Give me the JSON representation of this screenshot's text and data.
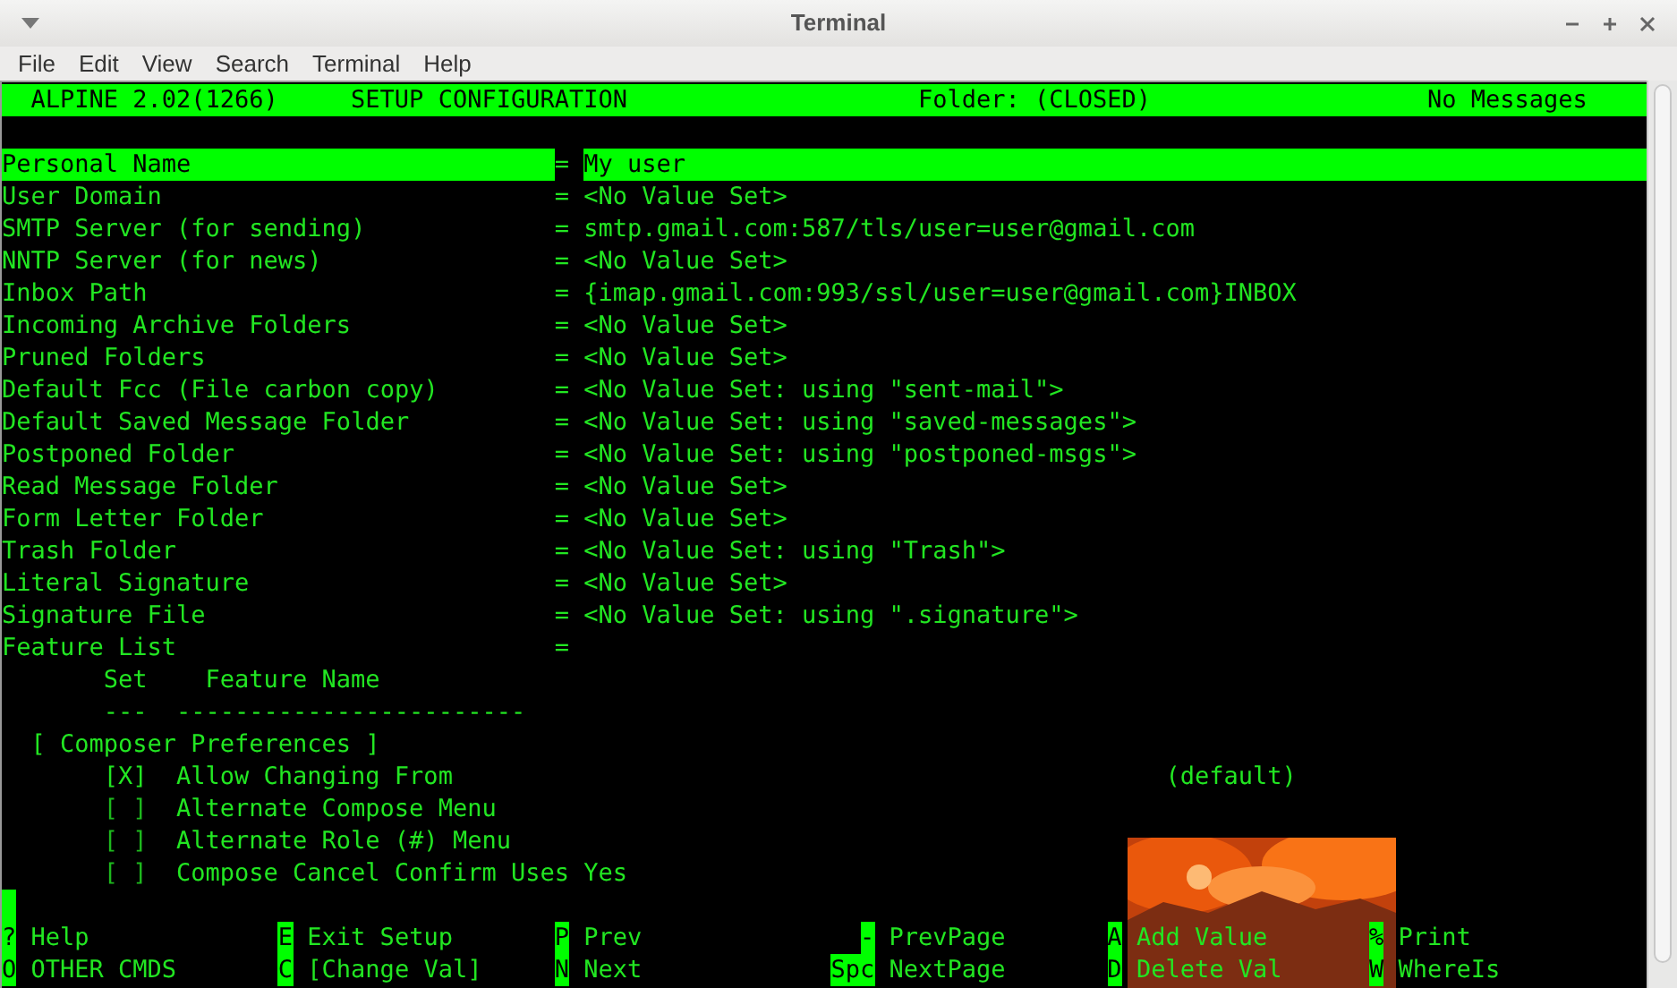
{
  "window": {
    "title": "Terminal"
  },
  "menu": [
    "File",
    "Edit",
    "View",
    "Search",
    "Terminal",
    "Help"
  ],
  "header": {
    "app": "ALPINE 2.02(1266)",
    "screen": "SETUP CONFIGURATION",
    "folder": "Folder: (CLOSED)",
    "messages": "No Messages"
  },
  "settings": [
    {
      "label": "Personal Name",
      "sep": "=",
      "value": "My user",
      "selected": true
    },
    {
      "label": "User Domain",
      "sep": "=",
      "value": "<No Value Set>",
      "selected": false
    },
    {
      "label": "SMTP Server (for sending)",
      "sep": "=",
      "value": "smtp.gmail.com:587/tls/user=user@gmail.com",
      "selected": false
    },
    {
      "label": "NNTP Server (for news)",
      "sep": "=",
      "value": "<No Value Set>",
      "selected": false
    },
    {
      "label": "Inbox Path",
      "sep": "=",
      "value": "{imap.gmail.com:993/ssl/user=user@gmail.com}INBOX",
      "selected": false
    },
    {
      "label": "Incoming Archive Folders",
      "sep": "=",
      "value": "<No Value Set>",
      "selected": false
    },
    {
      "label": "Pruned Folders",
      "sep": "=",
      "value": "<No Value Set>",
      "selected": false
    },
    {
      "label": "Default Fcc (File carbon copy)",
      "sep": "=",
      "value": "<No Value Set: using \"sent-mail\">",
      "selected": false
    },
    {
      "label": "Default Saved Message Folder",
      "sep": "=",
      "value": "<No Value Set: using \"saved-messages\">",
      "selected": false
    },
    {
      "label": "Postponed Folder",
      "sep": "=",
      "value": "<No Value Set: using \"postponed-msgs\">",
      "selected": false
    },
    {
      "label": "Read Message Folder",
      "sep": "=",
      "value": "<No Value Set>",
      "selected": false
    },
    {
      "label": "Form Letter Folder",
      "sep": "=",
      "value": "<No Value Set>",
      "selected": false
    },
    {
      "label": "Trash Folder",
      "sep": "=",
      "value": "<No Value Set: using \"Trash\">",
      "selected": false
    },
    {
      "label": "Literal Signature",
      "sep": "=",
      "value": "<No Value Set>",
      "selected": false
    },
    {
      "label": "Signature File",
      "sep": "=",
      "value": "<No Value Set: using \".signature\">",
      "selected": false
    }
  ],
  "feature_list": {
    "label": "Feature List",
    "sep": "=",
    "columns": [
      "Set",
      "Feature Name"
    ],
    "rules": [
      "---",
      "------------------------"
    ],
    "section": "[ Composer Preferences ]",
    "features": [
      {
        "box": "[X]",
        "name": "Allow Changing From",
        "note": "(default)",
        "checked": true
      },
      {
        "box": "[ ]",
        "name": "Alternate Compose Menu",
        "checked": false
      },
      {
        "box": "[ ]",
        "name": "Alternate Role (#) Menu",
        "checked": false
      },
      {
        "box": "[ ]",
        "name": "Compose Cancel Confirm Uses Yes",
        "checked": false
      }
    ]
  },
  "commands": [
    [
      {
        "key": "?",
        "label": "Help"
      },
      {
        "key": "O",
        "label": "OTHER CMDS"
      }
    ],
    [
      {
        "key": "E",
        "label": "Exit Setup"
      },
      {
        "key": "C",
        "label": "[Change Val]"
      }
    ],
    [
      {
        "key": "P",
        "label": "Prev"
      },
      {
        "key": "N",
        "label": "Next"
      }
    ],
    [
      {
        "key": "-",
        "label": "PrevPage"
      },
      {
        "key": "Spc",
        "label": "NextPage"
      }
    ],
    [
      {
        "key": "A",
        "label": "Add Value"
      },
      {
        "key": "D",
        "label": "Delete Val"
      }
    ],
    [
      {
        "key": "%",
        "label": "Print"
      },
      {
        "key": "W",
        "label": "WhereIs"
      }
    ]
  ]
}
